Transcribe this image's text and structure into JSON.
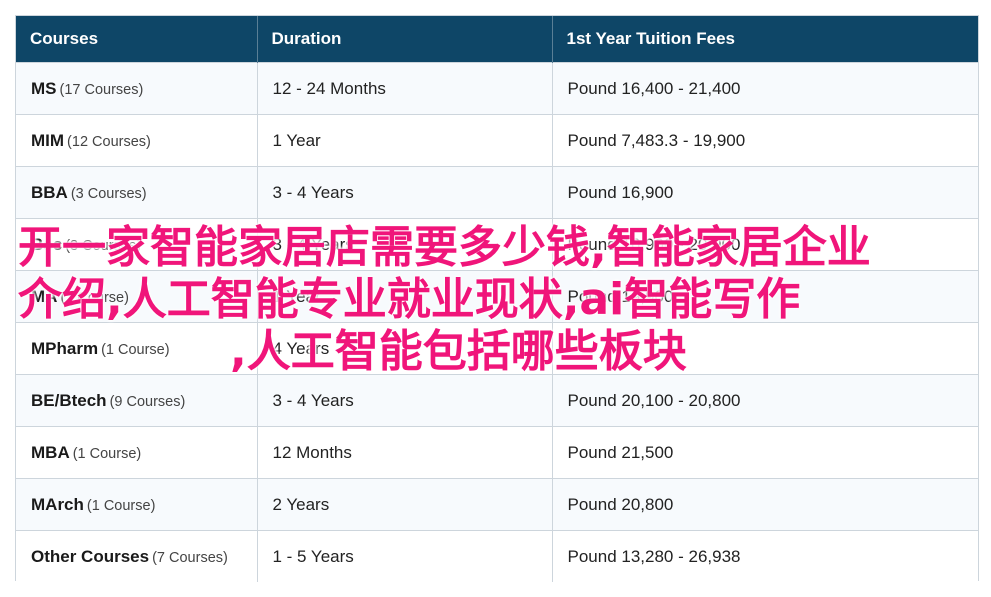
{
  "table": {
    "headers": [
      "Courses",
      "Duration",
      "1st Year Tuition Fees"
    ],
    "rows": [
      {
        "name": "MS",
        "count": "(17 Courses)",
        "duration": "12 - 24 Months",
        "fees": "Pound 16,400 - 21,400"
      },
      {
        "name": "MIM",
        "count": "(12 Courses)",
        "duration": "1 Year",
        "fees": "Pound 7,483.3 - 19,900"
      },
      {
        "name": "BBA",
        "count": "(3 Courses)",
        "duration": "3 - 4 Years",
        "fees": "Pound 16,900"
      },
      {
        "name": "Bsc",
        "count": "(3 Courses)",
        "duration": "3 - 4 Years",
        "fees": "Pound 16,900 - 20,900"
      },
      {
        "name": "MA",
        "count": "(1 Course)",
        "duration": "1 Year",
        "fees": "Pound 19,900"
      },
      {
        "name": "MPharm",
        "count": "(1 Course)",
        "duration": "4 Years",
        "fees": ""
      },
      {
        "name": "BE/Btech",
        "count": "(9 Courses)",
        "duration": "3 - 4 Years",
        "fees": "Pound 20,100 - 20,800"
      },
      {
        "name": "MBA",
        "count": "(1 Course)",
        "duration": "12 Months",
        "fees": "Pound 21,500"
      },
      {
        "name": "MArch",
        "count": "(1 Course)",
        "duration": "2 Years",
        "fees": "Pound 20,800"
      },
      {
        "name": "Other Courses",
        "count": "(7 Courses)",
        "duration": "1 - 5 Years",
        "fees": "Pound 13,280 - 26,938"
      }
    ]
  },
  "overlay": {
    "line1": "开一家智能家居店需要多少钱,智能家居企业",
    "line2": "介绍,人工智能专业就业现状,ai智能写作",
    "line3": ",人工智能包括哪些板块"
  },
  "colors": {
    "header_bg": "#0e4667",
    "overlay_text": "#f0157a"
  }
}
